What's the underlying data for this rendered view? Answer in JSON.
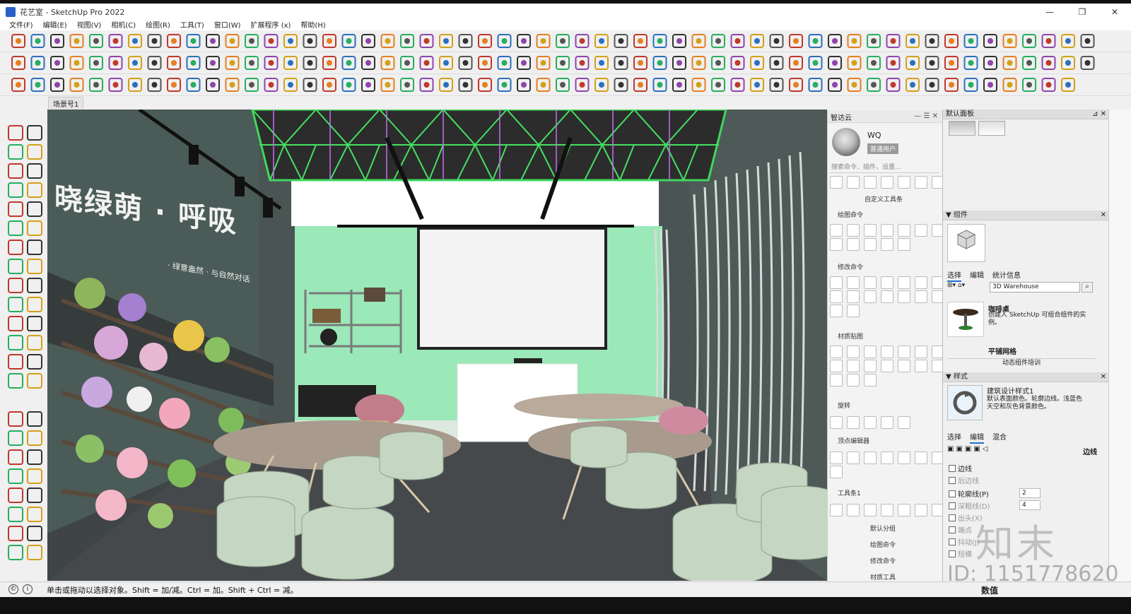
{
  "window": {
    "title": "花艺室 - SketchUp Pro 2022",
    "controls": [
      "—",
      "❐",
      "✕"
    ]
  },
  "menu": [
    "文件(F)",
    "编辑(E)",
    "视图(V)",
    "相机(C)",
    "绘图(R)",
    "工具(T)",
    "窗口(W)",
    "扩展程序 (x)",
    "帮助(H)"
  ],
  "scene_tabs": [
    "场景号1"
  ],
  "viewport": {
    "wall_text_big": "晓绿萌 · 呼吸",
    "wall_text_small": "· 绿意盎然 · 与自然对话"
  },
  "zhida": {
    "title": "智达云",
    "user": "WQ",
    "badge": "普通用户",
    "search": "搜索命令、插件、设置...",
    "sections": [
      "自定义工具条",
      "绘图命令",
      "修改命令",
      "材质贴图",
      "旋转",
      "顶点编辑器",
      "工具条1"
    ],
    "bottom_labels": [
      "默认分组",
      "绘图命令",
      "修改命令",
      "材质工具"
    ]
  },
  "tray": {
    "title": "默认面板",
    "components": {
      "title": "组件",
      "tabs": [
        "选择",
        "编辑",
        "统计信息"
      ],
      "search_placeholder": "3D Warehouse",
      "items": [
        {
          "name": "咖啡桌",
          "desc": "创建人 SketchUp 可组合组件的实例。"
        },
        {
          "name": "平铺网格",
          "desc": "动态组件培训"
        }
      ],
      "footer": "动态组件培训"
    },
    "styles": {
      "title": "样式",
      "name": "建筑设计样式1",
      "desc": "默认表面颜色。轮廓边线。浅蓝色天空和灰色背景颜色。",
      "tabs": [
        "选择",
        "编辑",
        "混合"
      ],
      "edge_label": "边线",
      "options": [
        {
          "label": "边线",
          "checked": false
        },
        {
          "label": "后边线",
          "checked": false,
          "disabled": true
        },
        {
          "label": "轮廓线(P)",
          "checked": false,
          "value": "2"
        },
        {
          "label": "深粗线(D)",
          "checked": false,
          "value": "4",
          "disabled": true
        },
        {
          "label": "出头(X)",
          "checked": false,
          "disabled": true
        },
        {
          "label": "端点",
          "checked": false,
          "disabled": true
        },
        {
          "label": "抖动(J)",
          "checked": false,
          "disabled": true
        },
        {
          "label": "短横",
          "checked": false,
          "disabled": true
        }
      ]
    }
  },
  "status": {
    "text": "单击或拖动以选择对象。Shift = 加/减。Ctrl = 加。Shift + Ctrl = 减。",
    "measure_label": "数值"
  },
  "watermark": {
    "logo": "知末",
    "id": "ID: 1151778620"
  }
}
